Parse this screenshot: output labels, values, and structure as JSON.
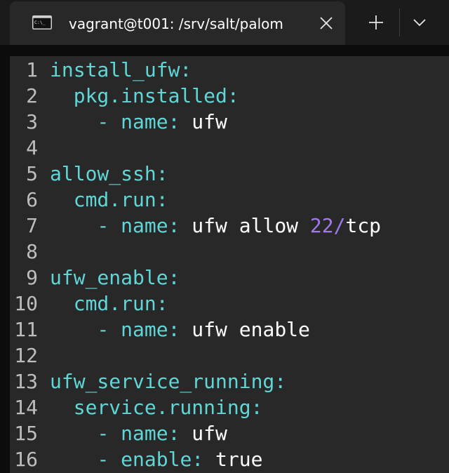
{
  "window": {
    "tab_title": "vagrant@t001: /srv/salt/palom",
    "tab_icon": "terminal-icon",
    "close_icon": "close-icon",
    "new_tab_icon": "plus-icon",
    "dropdown_icon": "chevron-down-icon"
  },
  "colors": {
    "key": "#61d6d6",
    "number": "#a07ae8",
    "text": "#ffffff",
    "line_number": "#bdbdbd",
    "editor_background": "#282828"
  },
  "editor": {
    "lines": [
      {
        "num": "1",
        "indent": "",
        "parts": [
          {
            "t": "install_ufw:",
            "c": "key"
          }
        ]
      },
      {
        "num": "2",
        "indent": "  ",
        "parts": [
          {
            "t": "pkg.installed:",
            "c": "key"
          }
        ]
      },
      {
        "num": "3",
        "indent": "    ",
        "parts": [
          {
            "t": "- name:",
            "c": "key"
          },
          {
            "t": " ufw",
            "c": "val"
          }
        ]
      },
      {
        "num": "4",
        "indent": "",
        "parts": []
      },
      {
        "num": "5",
        "indent": "",
        "parts": [
          {
            "t": "allow_ssh:",
            "c": "key"
          }
        ]
      },
      {
        "num": "6",
        "indent": "  ",
        "parts": [
          {
            "t": "cmd.run:",
            "c": "key"
          }
        ]
      },
      {
        "num": "7",
        "indent": "    ",
        "parts": [
          {
            "t": "- name:",
            "c": "key"
          },
          {
            "t": " ufw allow ",
            "c": "val"
          },
          {
            "t": "22/",
            "c": "num"
          },
          {
            "t": "tcp",
            "c": "val"
          }
        ]
      },
      {
        "num": "8",
        "indent": "",
        "parts": []
      },
      {
        "num": "9",
        "indent": "",
        "parts": [
          {
            "t": "ufw_enable:",
            "c": "key"
          }
        ]
      },
      {
        "num": "10",
        "indent": "  ",
        "parts": [
          {
            "t": "cmd.run:",
            "c": "key"
          }
        ]
      },
      {
        "num": "11",
        "indent": "    ",
        "parts": [
          {
            "t": "- name:",
            "c": "key"
          },
          {
            "t": " ufw enable",
            "c": "val"
          }
        ]
      },
      {
        "num": "12",
        "indent": "",
        "parts": []
      },
      {
        "num": "13",
        "indent": "",
        "parts": [
          {
            "t": "ufw_service_running:",
            "c": "key"
          }
        ]
      },
      {
        "num": "14",
        "indent": "  ",
        "parts": [
          {
            "t": "service.running:",
            "c": "key"
          }
        ]
      },
      {
        "num": "15",
        "indent": "    ",
        "parts": [
          {
            "t": "- name:",
            "c": "key"
          },
          {
            "t": " ufw",
            "c": "val"
          }
        ]
      },
      {
        "num": "16",
        "indent": "    ",
        "parts": [
          {
            "t": "- enable:",
            "c": "key"
          },
          {
            "t": " true",
            "c": "val"
          }
        ]
      }
    ]
  }
}
